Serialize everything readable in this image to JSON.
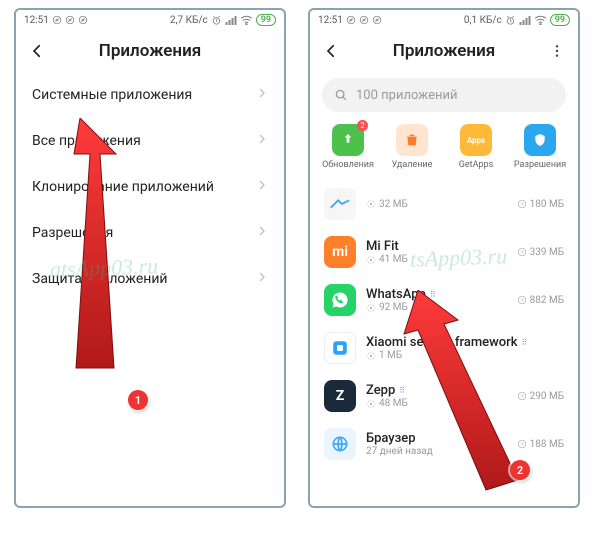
{
  "status": {
    "time": "12:51",
    "net": "2,7 КБ/с",
    "net2": "0,1 КБ/с",
    "battery": "99"
  },
  "left": {
    "title": "Приложения",
    "items": [
      "Системные приложения",
      "Все приложения",
      "Клонирование приложений",
      "Разрешения",
      "Защита приложений"
    ]
  },
  "right": {
    "title": "Приложения",
    "search_placeholder": "100 приложений",
    "quick": {
      "updates": "Обновления",
      "updates_badge": "2",
      "uninstall": "Удаление",
      "getapps": "GetApps",
      "permissions": "Разрешения"
    },
    "apps": [
      {
        "name": "",
        "size": "32 МБ",
        "right": "180 МБ",
        "color": "#f6f6f6"
      },
      {
        "name": "Mi Fit",
        "size": "41 МБ",
        "right": "339 МБ",
        "color": "#ff7f2a"
      },
      {
        "name": "WhatsApp",
        "size": "92 МБ",
        "right": "882 МБ",
        "color": "#25d366"
      },
      {
        "name": "Xiaomi service framework",
        "size": "1 МБ",
        "right": "",
        "color": "#2aa0ff"
      },
      {
        "name": "Zepp",
        "size": "48 МБ",
        "right": "290 МБ",
        "color": "#1b2a3a"
      },
      {
        "name": "Браузер",
        "size": "27 дней назад",
        "right": "188 МБ",
        "color": "#3aa8ff"
      }
    ]
  },
  "overlay": {
    "watermark": "atsApp03.ru",
    "watermark2": "tsApp03.ru",
    "step1": "1",
    "step2": "2"
  }
}
